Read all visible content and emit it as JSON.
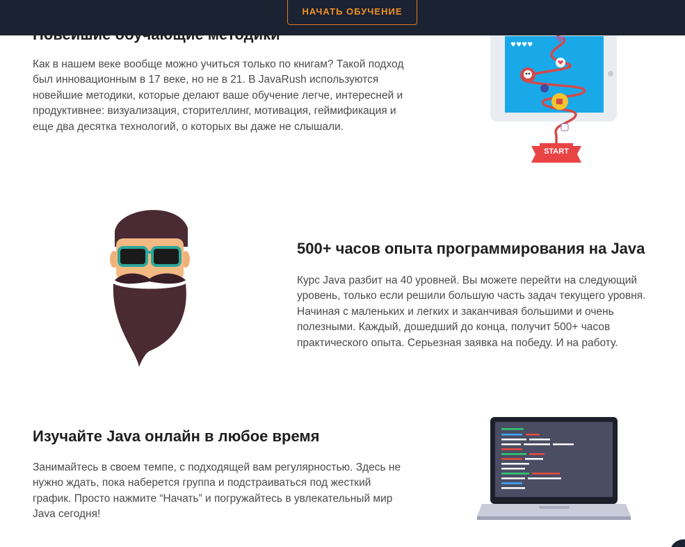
{
  "header": {
    "cta_label": "НАЧАТЬ ОБУЧЕНИЕ"
  },
  "section1": {
    "title": "Новейшие обучающие методики",
    "body": "Как в нашем веке вообще можно учиться только по книгам? Такой подход был инновационным в 17 веке, но не в 21. В JavaRush используются новейшие методики, которые делают ваше обучение легче, интересней и продуктивнее: визуализация, сторителлинг, мотивация, геймификация и еще два десятка технологий, о которых вы даже не слышали."
  },
  "section2": {
    "title": "500+ часов опыта программирования на Java",
    "body": "Курс Java разбит на 40 уровней. Вы можете перейти на следующий уровень, только если решили большую часть задач текущего уровня. Начиная с маленьких и легких и заканчивая большими и очень полезными. Каждый, дошедший до конца, получит 500+ часов практического опыта. Серьезная заявка на победу. И на работу."
  },
  "section3": {
    "title": "Изучайте Java онлайн в любое время",
    "body": "Занимайтесь в своем темпе, с подходящей вам регулярностью. Здесь не нужно ждать, пока наберется группа и подстраиваться под жесткий график. Просто нажмите “Начать” и погружайтесь в увлекательный мир Java сегодня!"
  },
  "illustrations": {
    "game_start_label": "START",
    "game_hearts": "♥♥♥♥"
  },
  "colors": {
    "header_bg": "#1b2232",
    "accent_orange": "#f19226",
    "game_screen": "#1aa9e8",
    "path_red": "#d24a4a",
    "beard": "#4a2a33",
    "glasses": "#2ba79a",
    "laptop_screen": "#4a4d63"
  }
}
